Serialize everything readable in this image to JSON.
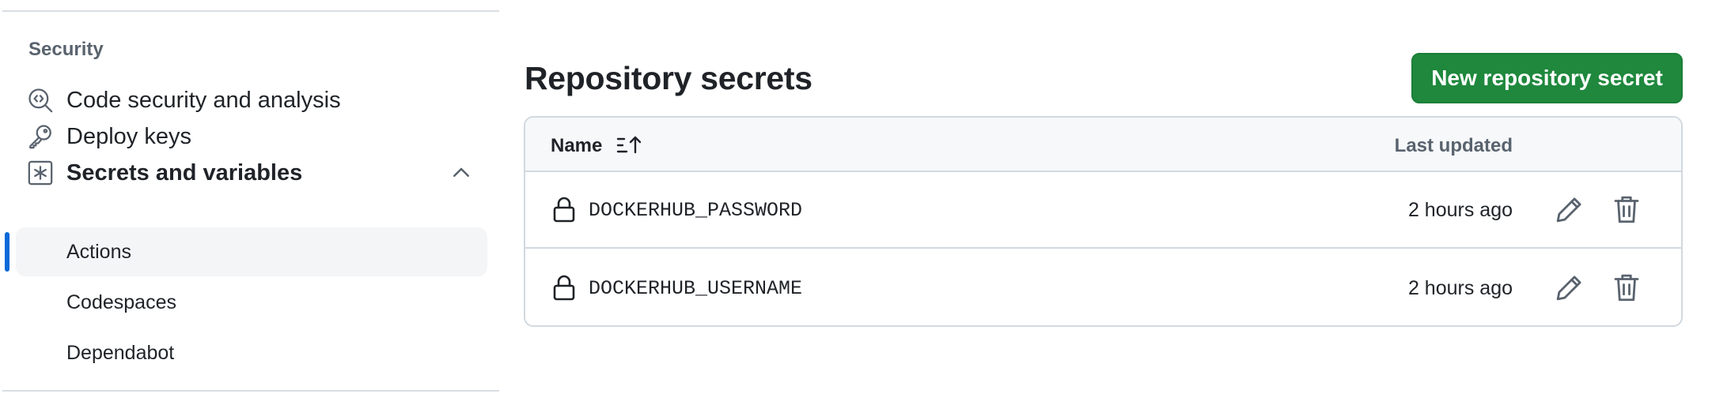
{
  "sidebar": {
    "section_heading": "Security",
    "items": [
      {
        "label": "Code security and analysis",
        "icon": "codescan-icon"
      },
      {
        "label": "Deploy keys",
        "icon": "key-icon"
      },
      {
        "label": "Secrets and variables",
        "icon": "asterisk-icon",
        "expanded": true
      }
    ],
    "subitems": [
      {
        "label": "Actions",
        "active": true
      },
      {
        "label": "Codespaces",
        "active": false
      },
      {
        "label": "Dependabot",
        "active": false
      }
    ]
  },
  "main": {
    "title": "Repository secrets",
    "new_button_label": "New repository secret",
    "table": {
      "columns": {
        "name": "Name",
        "last_updated": "Last updated"
      },
      "sort_icon": "sort-ascending-icon",
      "rows": [
        {
          "name": "DOCKERHUB_PASSWORD",
          "updated": "2 hours ago"
        },
        {
          "name": "DOCKERHUB_USERNAME",
          "updated": "2 hours ago"
        }
      ]
    }
  },
  "colors": {
    "primary_button": "#1f883d",
    "active_indicator": "#0969da",
    "muted_text": "#59636e",
    "border": "#d1d9e0"
  }
}
